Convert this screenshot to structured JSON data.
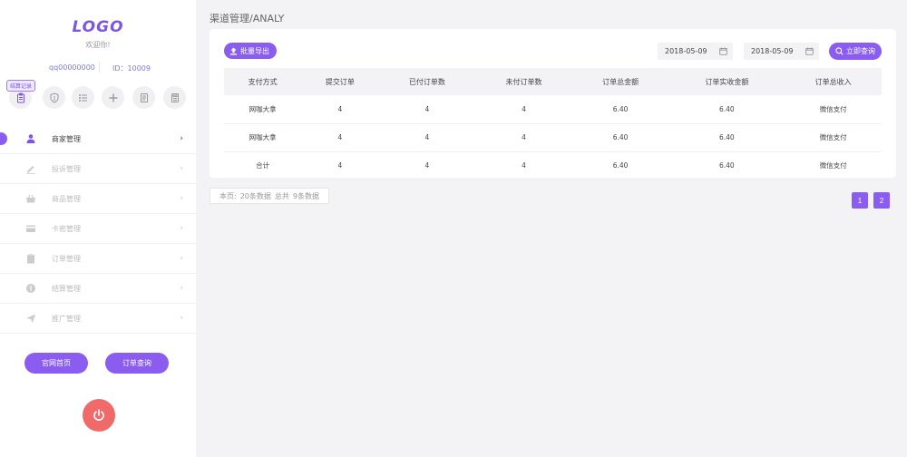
{
  "sidebar": {
    "logo": "LOGO",
    "welcome": "欢迎你!",
    "qq": "qq00000000",
    "id": "ID：10009",
    "badge": "结算记录",
    "icons": [
      "clipboard-icon",
      "shield-icon",
      "list-icon",
      "plus-icon",
      "document-icon",
      "calculator-icon"
    ],
    "menu": [
      {
        "label": "商家管理",
        "icon": "user-icon",
        "active": true
      },
      {
        "label": "投诉管理",
        "icon": "pencil-icon",
        "active": false
      },
      {
        "label": "商品管理",
        "icon": "basket-icon",
        "active": false
      },
      {
        "label": "卡密管理",
        "icon": "card-icon",
        "active": false
      },
      {
        "label": "订单管理",
        "icon": "clipboard-icon",
        "active": false
      },
      {
        "label": "结算管理",
        "icon": "coin-icon",
        "active": false
      },
      {
        "label": "推广管理",
        "icon": "send-icon",
        "active": false
      }
    ],
    "home_button": "官网首页",
    "order_query_button": "订单查询"
  },
  "main": {
    "breadcrumb": "渠道管理/ANALY",
    "export_button": "批量导出",
    "date_start": "2018-05-09",
    "date_end": "2018-05-09",
    "search_button": "立即查询",
    "table": {
      "headers": [
        "支付方式",
        "提交订单",
        "已付订单数",
        "未付订单数",
        "订单总金额",
        "订单实收金额",
        "订单总收入"
      ],
      "rows": [
        [
          "网咖大拿",
          "4",
          "4",
          "4",
          "6.40",
          "6.40",
          "微信支付"
        ],
        [
          "网咖大拿",
          "4",
          "4",
          "4",
          "6.40",
          "6.40",
          "微信支付"
        ],
        [
          "合计",
          "4",
          "4",
          "4",
          "6.40",
          "6.40",
          "微信支付"
        ]
      ]
    },
    "footer": {
      "this_page": "本页:",
      "this_page_count": "20条数据",
      "total": "总共",
      "total_count": "9条数据"
    },
    "pages": [
      "1",
      "2"
    ]
  },
  "colors": {
    "accent": "#8a5cf0",
    "power": "#f06a6a",
    "background": "#f3f3f6"
  }
}
